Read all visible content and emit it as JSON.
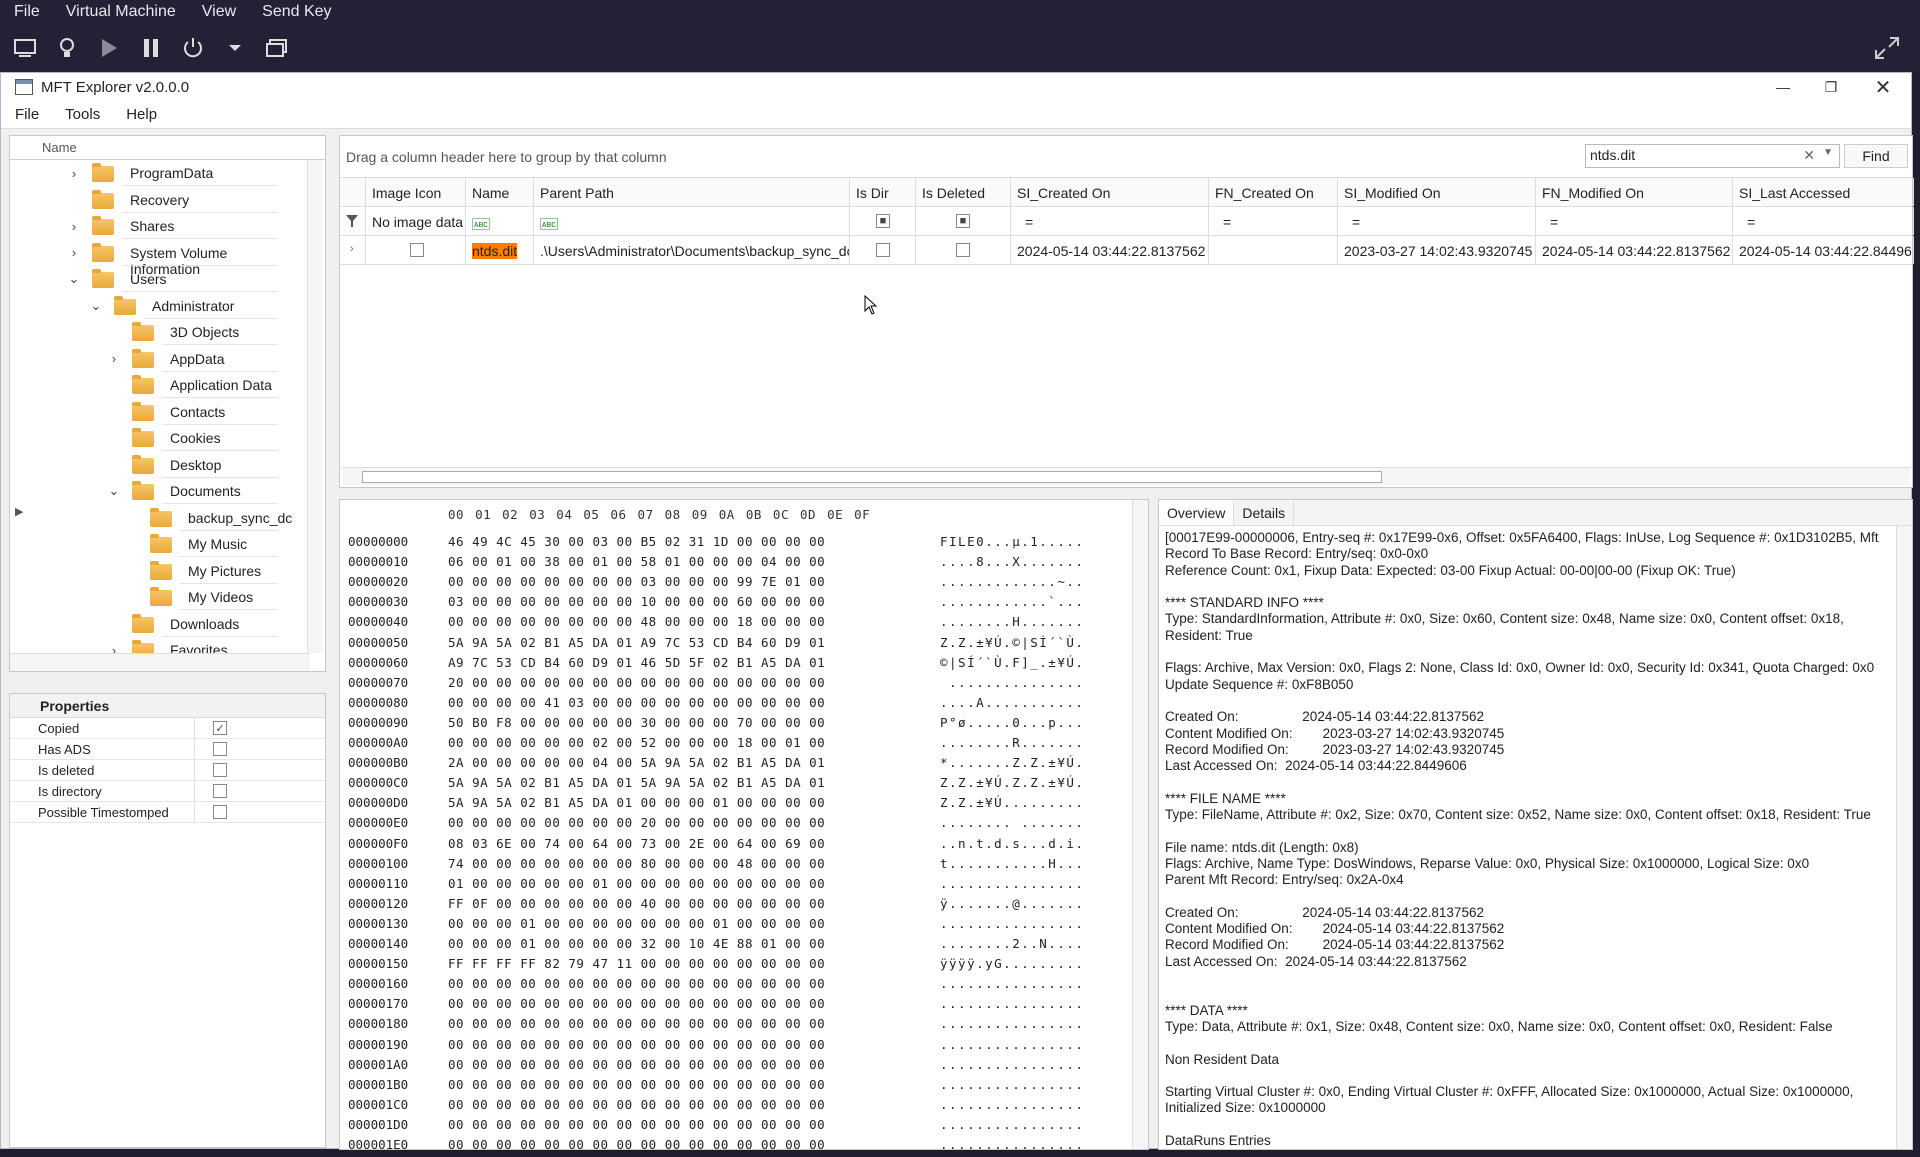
{
  "vm": {
    "menu": [
      "File",
      "Virtual Machine",
      "View",
      "Send Key"
    ]
  },
  "window": {
    "title": "MFT Explorer v2.0.0.0"
  },
  "menubar": [
    "File",
    "Tools",
    "Help"
  ],
  "tree": {
    "header": "Name",
    "items": [
      {
        "label": "ProgramData",
        "expander": "›"
      },
      {
        "label": "Recovery",
        "expander": ""
      },
      {
        "label": "Shares",
        "expander": "›"
      },
      {
        "label": "System Volume Information",
        "expander": "›"
      },
      {
        "label": "Users",
        "expander": "⌄"
      },
      {
        "label": "Administrator",
        "expander": "⌄"
      },
      {
        "label": "3D Objects",
        "expander": ""
      },
      {
        "label": "AppData",
        "expander": "›"
      },
      {
        "label": "Application Data",
        "expander": ""
      },
      {
        "label": "Contacts",
        "expander": ""
      },
      {
        "label": "Cookies",
        "expander": ""
      },
      {
        "label": "Desktop",
        "expander": ""
      },
      {
        "label": "Documents",
        "expander": "⌄"
      },
      {
        "label": "backup_sync_dc",
        "expander": ""
      },
      {
        "label": "My Music",
        "expander": ""
      },
      {
        "label": "My Pictures",
        "expander": ""
      },
      {
        "label": "My Videos",
        "expander": ""
      },
      {
        "label": "Downloads",
        "expander": ""
      },
      {
        "label": "Favorites",
        "expander": "›"
      }
    ]
  },
  "properties": {
    "title": "Properties",
    "rows": [
      {
        "label": "Copied",
        "checked": true
      },
      {
        "label": "Has ADS",
        "checked": false
      },
      {
        "label": "Is deleted",
        "checked": false
      },
      {
        "label": "Is directory",
        "checked": false
      },
      {
        "label": "Possible Timestomped",
        "checked": false
      }
    ]
  },
  "grid": {
    "group_hint": "Drag a column header here to group by that column",
    "search_value": "ntds.dit",
    "find_label": "Find",
    "columns": [
      "Image Icon",
      "Name",
      "Parent Path",
      "Is Dir",
      "Is Deleted",
      "SI_Created On",
      "FN_Created On",
      "SI_Modified On",
      "FN_Modified On",
      "SI_Last Accessed"
    ],
    "filter_image": "No image data",
    "filter_eq": "=",
    "filter_tag": "ᴀʙc",
    "row": {
      "name": "ntds.dit",
      "parent": ".\\Users\\Administrator\\Documents\\backup_sync_dc",
      "si_created": "2024-05-14 03:44:22.8137562",
      "fn_created": "",
      "si_modified": "2023-03-27 14:02:43.9320745",
      "fn_modified": "2024-05-14 03:44:22.8137562",
      "si_accessed": "2024-05-14 03:44:22.84496"
    }
  },
  "hex": {
    "header": "00 01 02 03 04 05 06 07 08 09 0A 0B 0C 0D 0E 0F",
    "lines": [
      {
        "o": "00000000",
        "b": "46 49 4C 45 30 00 03 00 B5 02 31 1D 00 00 00 00",
        "a": "FILE0...µ.1....."
      },
      {
        "o": "00000010",
        "b": "06 00 01 00 38 00 01 00 58 01 00 00 00 04 00 00",
        "a": "....8...X......."
      },
      {
        "o": "00000020",
        "b": "00 00 00 00 00 00 00 00 03 00 00 00 99 7E 01 00",
        "a": ".............~.."
      },
      {
        "o": "00000030",
        "b": "03 00 00 00 00 00 00 00 10 00 00 00 60 00 00 00",
        "a": "............`..."
      },
      {
        "o": "00000040",
        "b": "00 00 00 00 00 00 00 00 48 00 00 00 18 00 00 00",
        "a": "........H......."
      },
      {
        "o": "00000050",
        "b": "5A 9A 5A 02 B1 A5 DA 01 A9 7C 53 CD B4 60 D9 01",
        "a": "Z.Z.±¥Ú.©|SÍ´`Ù."
      },
      {
        "o": "00000060",
        "b": "A9 7C 53 CD B4 60 D9 01 46 5D 5F 02 B1 A5 DA 01",
        "a": "©|SÍ´`Ù.F]_.±¥Ú."
      },
      {
        "o": "00000070",
        "b": "20 00 00 00 00 00 00 00 00 00 00 00 00 00 00 00",
        "a": " ..............."
      },
      {
        "o": "00000080",
        "b": "00 00 00 00 41 03 00 00 00 00 00 00 00 00 00 00",
        "a": "....A..........."
      },
      {
        "o": "00000090",
        "b": "50 B0 F8 00 00 00 00 00 30 00 00 00 70 00 00 00",
        "a": "P°ø.....0...p..."
      },
      {
        "o": "000000A0",
        "b": "00 00 00 00 00 00 02 00 52 00 00 00 18 00 01 00",
        "a": "........R......."
      },
      {
        "o": "000000B0",
        "b": "2A 00 00 00 00 00 04 00 5A 9A 5A 02 B1 A5 DA 01",
        "a": "*.......Z.Z.±¥Ú."
      },
      {
        "o": "000000C0",
        "b": "5A 9A 5A 02 B1 A5 DA 01 5A 9A 5A 02 B1 A5 DA 01",
        "a": "Z.Z.±¥Ú.Z.Z.±¥Ú."
      },
      {
        "o": "000000D0",
        "b": "5A 9A 5A 02 B1 A5 DA 01 00 00 00 01 00 00 00 00",
        "a": "Z.Z.±¥Ú........."
      },
      {
        "o": "000000E0",
        "b": "00 00 00 00 00 00 00 00 20 00 00 00 00 00 00 00",
        "a": "........ ......."
      },
      {
        "o": "000000F0",
        "b": "08 03 6E 00 74 00 64 00 73 00 2E 00 64 00 69 00",
        "a": "..n.t.d.s...d.i."
      },
      {
        "o": "00000100",
        "b": "74 00 00 00 00 00 00 00 80 00 00 00 48 00 00 00",
        "a": "t...........H..."
      },
      {
        "o": "00000110",
        "b": "01 00 00 00 00 00 01 00 00 00 00 00 00 00 00 00",
        "a": "................"
      },
      {
        "o": "00000120",
        "b": "FF 0F 00 00 00 00 00 00 40 00 00 00 00 00 00 00",
        "a": "ÿ.......@......."
      },
      {
        "o": "00000130",
        "b": "00 00 00 01 00 00 00 00 00 00 00 01 00 00 00 00",
        "a": "................"
      },
      {
        "o": "00000140",
        "b": "00 00 00 01 00 00 00 00 32 00 10 4E 88 01 00 00",
        "a": "........2..N...."
      },
      {
        "o": "00000150",
        "b": "FF FF FF FF 82 79 47 11 00 00 00 00 00 00 00 00",
        "a": "ÿÿÿÿ.yG........."
      },
      {
        "o": "00000160",
        "b": "00 00 00 00 00 00 00 00 00 00 00 00 00 00 00 00",
        "a": "................"
      },
      {
        "o": "00000170",
        "b": "00 00 00 00 00 00 00 00 00 00 00 00 00 00 00 00",
        "a": "................"
      },
      {
        "o": "00000180",
        "b": "00 00 00 00 00 00 00 00 00 00 00 00 00 00 00 00",
        "a": "................"
      },
      {
        "o": "00000190",
        "b": "00 00 00 00 00 00 00 00 00 00 00 00 00 00 00 00",
        "a": "................"
      },
      {
        "o": "000001A0",
        "b": "00 00 00 00 00 00 00 00 00 00 00 00 00 00 00 00",
        "a": "................"
      },
      {
        "o": "000001B0",
        "b": "00 00 00 00 00 00 00 00 00 00 00 00 00 00 00 00",
        "a": "................"
      },
      {
        "o": "000001C0",
        "b": "00 00 00 00 00 00 00 00 00 00 00 00 00 00 00 00",
        "a": "................"
      },
      {
        "o": "000001D0",
        "b": "00 00 00 00 00 00 00 00 00 00 00 00 00 00 00 00",
        "a": "................"
      },
      {
        "o": "000001E0",
        "b": "00 00 00 00 00 00 00 00 00 00 00 00 00 00 00 00",
        "a": "................"
      }
    ]
  },
  "overview": {
    "tabs": [
      "Overview",
      "Details"
    ],
    "text": "[00017E99-00000006, Entry-seq #: 0x17E99-0x6, Offset: 0x5FA6400, Flags: InUse, Log Sequence #: 0x1D3102B5, Mft\nRecord To Base Record: Entry/seq: 0x0-0x0\nReference Count: 0x1, Fixup Data: Expected: 03-00 Fixup Actual: 00-00|00-00 (Fixup OK: True)\n\n**** STANDARD INFO ****\nType: StandardInformation, Attribute #: 0x0, Size: 0x60, Content size: 0x48, Name size: 0x0, Content offset: 0x18,\nResident: True\n\nFlags: Archive, Max Version: 0x0, Flags 2: None, Class Id: 0x0, Owner Id: 0x0, Security Id: 0x341, Quota Charged: 0x0\nUpdate Sequence #: 0xF8B050\n\nCreated On:                 2024-05-14 03:44:22.8137562\nContent Modified On:        2023-03-27 14:02:43.9320745\nRecord Modified On:         2023-03-27 14:02:43.9320745\nLast Accessed On:  2024-05-14 03:44:22.8449606\n\n**** FILE NAME ****\nType: FileName, Attribute #: 0x2, Size: 0x70, Content size: 0x52, Name size: 0x0, Content offset: 0x18, Resident: True\n\nFile name: ntds.dit (Length: 0x8)\nFlags: Archive, Name Type: DosWindows, Reparse Value: 0x0, Physical Size: 0x1000000, Logical Size: 0x0\nParent Mft Record: Entry/seq: 0x2A-0x4\n\nCreated On:                 2024-05-14 03:44:22.8137562\nContent Modified On:        2024-05-14 03:44:22.8137562\nRecord Modified On:         2024-05-14 03:44:22.8137562\nLast Accessed On:  2024-05-14 03:44:22.8137562\n\n\n**** DATA ****\nType: Data, Attribute #: 0x1, Size: 0x48, Content size: 0x0, Name size: 0x0, Content offset: 0x0, Resident: False\n\nNon Resident Data\n\nStarting Virtual Cluster #: 0x0, Ending Virtual Cluster #: 0xFFF, Allocated Size: 0x1000000, Actual Size: 0x1000000,\nInitialized Size: 0x1000000\n\nDataRuns Entries"
  }
}
